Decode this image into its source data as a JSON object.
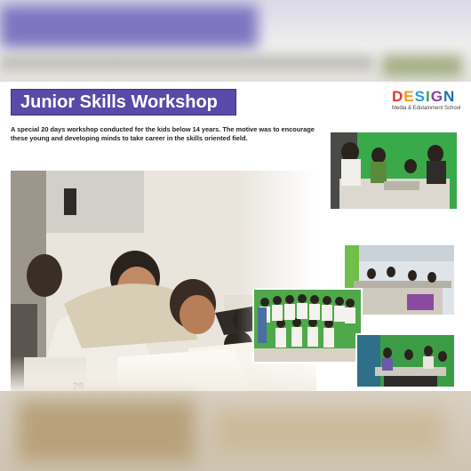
{
  "workshop": {
    "title": "Junior Skills Workshop",
    "description": "A special 20 days workshop conducted for the kids below 14 years. The motive was to encourage these young and developing minds to take career in the skills oriented field."
  },
  "logo": {
    "letters": [
      "D",
      "E",
      "S",
      "I",
      "G",
      "N"
    ],
    "subtitle": "Media & Edutainment School",
    "colors": [
      "#e8342e",
      "#f39a1f",
      "#2c9ad8",
      "#38a84a",
      "#8b3fa0",
      "#1c6fb5"
    ]
  },
  "colors": {
    "title_bg": "#5a4aa8",
    "green_screen": "#3aa94a"
  }
}
